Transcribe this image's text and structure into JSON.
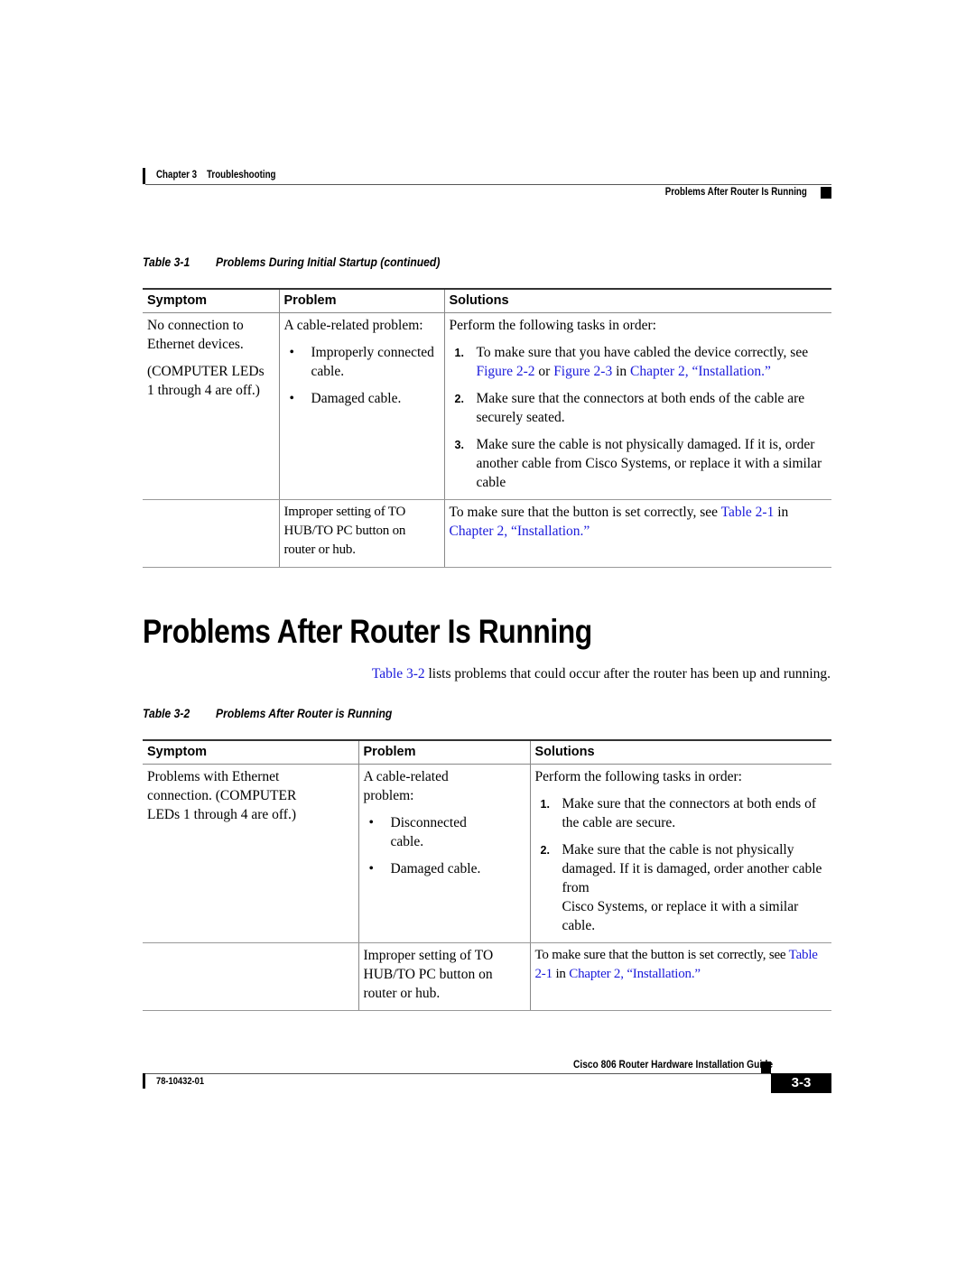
{
  "header": {
    "chapter_label": "Chapter 3",
    "chapter_title": "Troubleshooting",
    "section_title": "Problems After Router Is Running"
  },
  "table1": {
    "caption_number": "Table 3-1",
    "caption_title": "Problems During Initial Startup (continued)",
    "columns": [
      "Symptom",
      "Problem",
      "Solutions"
    ],
    "rows": [
      {
        "symptom_lines": [
          "No connection to Ethernet devices.",
          "(COMPUTER LEDs 1 through 4 are off.)"
        ],
        "problem_intro": "A cable-related problem:",
        "problem_bullets": [
          "Improperly connected cable.",
          "Damaged cable."
        ],
        "solution_intro": "Perform the following tasks in order:",
        "steps": [
          {
            "num": "1.",
            "text_a": "To make sure that you have cabled the device correctly, see ",
            "link_a": "Figure 2-2",
            "text_b": " or ",
            "link_b": "Figure 2-3",
            "text_c": " in ",
            "link_c": "Chapter 2, “Installation.”"
          },
          {
            "num": "2.",
            "text": "Make sure that the connectors at both ends of the cable are securely seated."
          },
          {
            "num": "3.",
            "text": "Make sure the cable is not physically damaged. If it is, order another cable from Cisco Systems, or replace it with a similar cable"
          }
        ]
      },
      {
        "symptom": "",
        "problem": "Improper setting of TO HUB/TO PC button on router or hub.",
        "solution_text": "To make sure that the button is set correctly, see ",
        "solution_link_a": "Table 2-1",
        "solution_mid": " in ",
        "solution_link_b": "Chapter 2, “Installation.”"
      }
    ]
  },
  "section": {
    "heading": "Problems After Router Is Running",
    "intro_link": "Table 3-2",
    "intro_text": " lists problems that could occur after the router has been up and running."
  },
  "table2": {
    "caption_number": "Table 3-2",
    "caption_title": "Problems After Router is Running",
    "columns": [
      "Symptom",
      "Problem",
      "Solutions"
    ],
    "rows": [
      {
        "symptom": "Problems with Ethernet connection. (COMPUTER LEDs 1 through 4 are off.)",
        "problem_intro": "A cable-related problem:",
        "problem_bullets": [
          "Disconnected cable.",
          "Damaged cable."
        ],
        "solution_intro": "Perform the following tasks in order:",
        "steps": [
          {
            "num": "1.",
            "text": "Make sure that the connectors at both ends of the cable are secure."
          },
          {
            "num": "2.",
            "text_a": "Make sure that the cable is not physically damaged. If it is damaged, order another cable from",
            "text_b": "Cisco Systems, or replace it with a similar cable."
          }
        ]
      },
      {
        "symptom": "",
        "problem": "Improper setting of TO HUB/TO PC button on router or hub.",
        "solution_text": "To make sure that the button is set correctly, see ",
        "solution_link_a": "Table 2-1",
        "solution_mid": " in ",
        "solution_link_b": "Chapter 2, “Installation.”"
      }
    ]
  },
  "footer": {
    "guide_title": "Cisco 806 Router Hardware Installation Guide",
    "doc_number": "78-10432-01",
    "page_number": "3-3"
  },
  "colors": {
    "link": "#1a1adb",
    "text": "#000000"
  }
}
